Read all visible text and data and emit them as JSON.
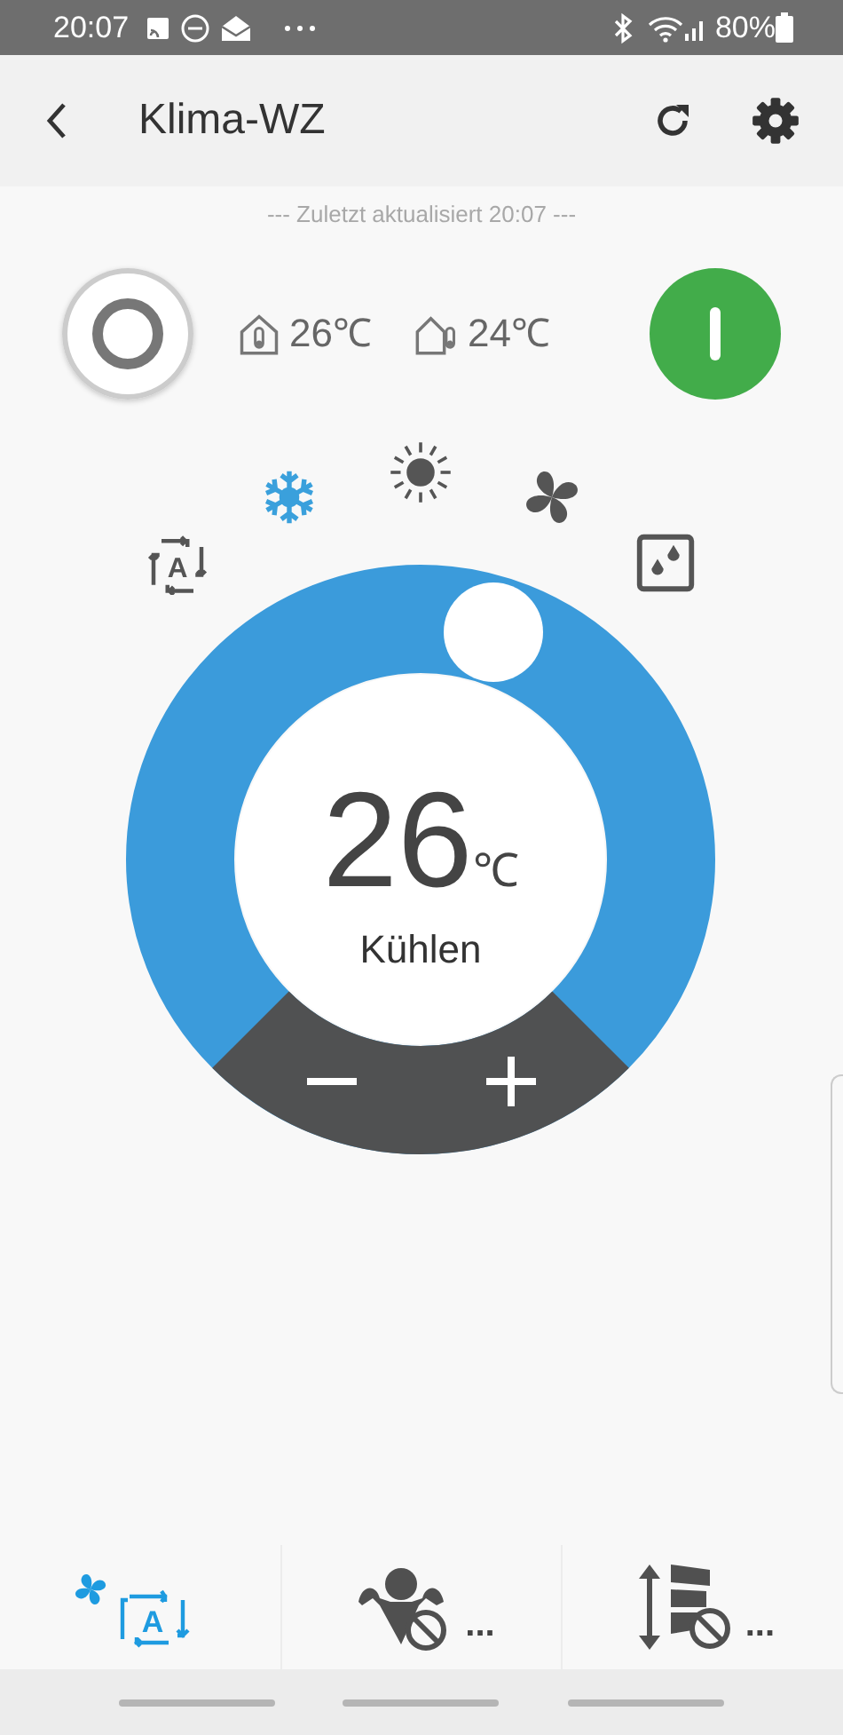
{
  "status_bar": {
    "time": "20:07",
    "battery": "80%"
  },
  "header": {
    "title": "Klima-WZ"
  },
  "last_updated": "--- Zuletzt aktualisiert 20:07 ---",
  "power": {
    "on": true
  },
  "indoor_temp": "26℃",
  "outdoor_temp": "24℃",
  "modes": [
    {
      "kind": "auto",
      "label": "A",
      "selected": false
    },
    {
      "kind": "cool",
      "selected": true
    },
    {
      "kind": "heat",
      "selected": false
    },
    {
      "kind": "fan",
      "selected": false
    },
    {
      "kind": "dry",
      "selected": false
    }
  ],
  "setpoint": {
    "value": "26",
    "unit": "℃",
    "mode_label": "Kühlen"
  },
  "bottom_buttons": [
    {
      "kind": "fan_speed",
      "label": "A",
      "active": true
    },
    {
      "kind": "turbo",
      "more": "...",
      "active": false
    },
    {
      "kind": "swing",
      "more": "...",
      "active": false
    }
  ]
}
